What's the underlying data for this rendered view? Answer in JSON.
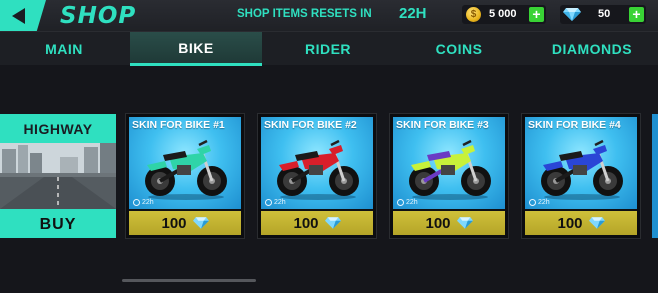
{
  "header": {
    "title": "SHOP",
    "reset_label": "SHOP ITEMS RESETS IN",
    "reset_value": "22H",
    "coins": "5 000",
    "diamonds": "50",
    "coin_symbol": "$"
  },
  "tabs": [
    {
      "label": "MAIN",
      "active": false
    },
    {
      "label": "BIKE",
      "active": true
    },
    {
      "label": "RIDER",
      "active": false
    },
    {
      "label": "COINS",
      "active": false
    },
    {
      "label": "DIAMONDS",
      "active": false
    }
  ],
  "highway": {
    "title": "HIGHWAY",
    "buy_label": "BUY"
  },
  "skins": [
    {
      "title": "SKIN FOR BIKE #1",
      "timer": "22h",
      "price": "100",
      "bike_color": "#2fd4a8",
      "accent": "#1b1b1b"
    },
    {
      "title": "SKIN FOR BIKE #2",
      "timer": "22h",
      "price": "100",
      "bike_color": "#d81f2a",
      "accent": "#1b1b1b"
    },
    {
      "title": "SKIN FOR BIKE #3",
      "timer": "22h",
      "price": "100",
      "bike_color": "#c8f23a",
      "accent": "#6a3bc4"
    },
    {
      "title": "SKIN FOR BIKE #4",
      "timer": "22h",
      "price": "100",
      "bike_color": "#2a46d6",
      "accent": "#1b1b1b"
    }
  ],
  "colors": {
    "accent": "#2fe0c0",
    "price_bar": "#cfc03a",
    "plus_button": "#39d335"
  },
  "icons": {
    "back": "back-arrow-icon",
    "coin": "coin-icon",
    "diamond": "diamond-icon",
    "clock": "clock-icon"
  }
}
